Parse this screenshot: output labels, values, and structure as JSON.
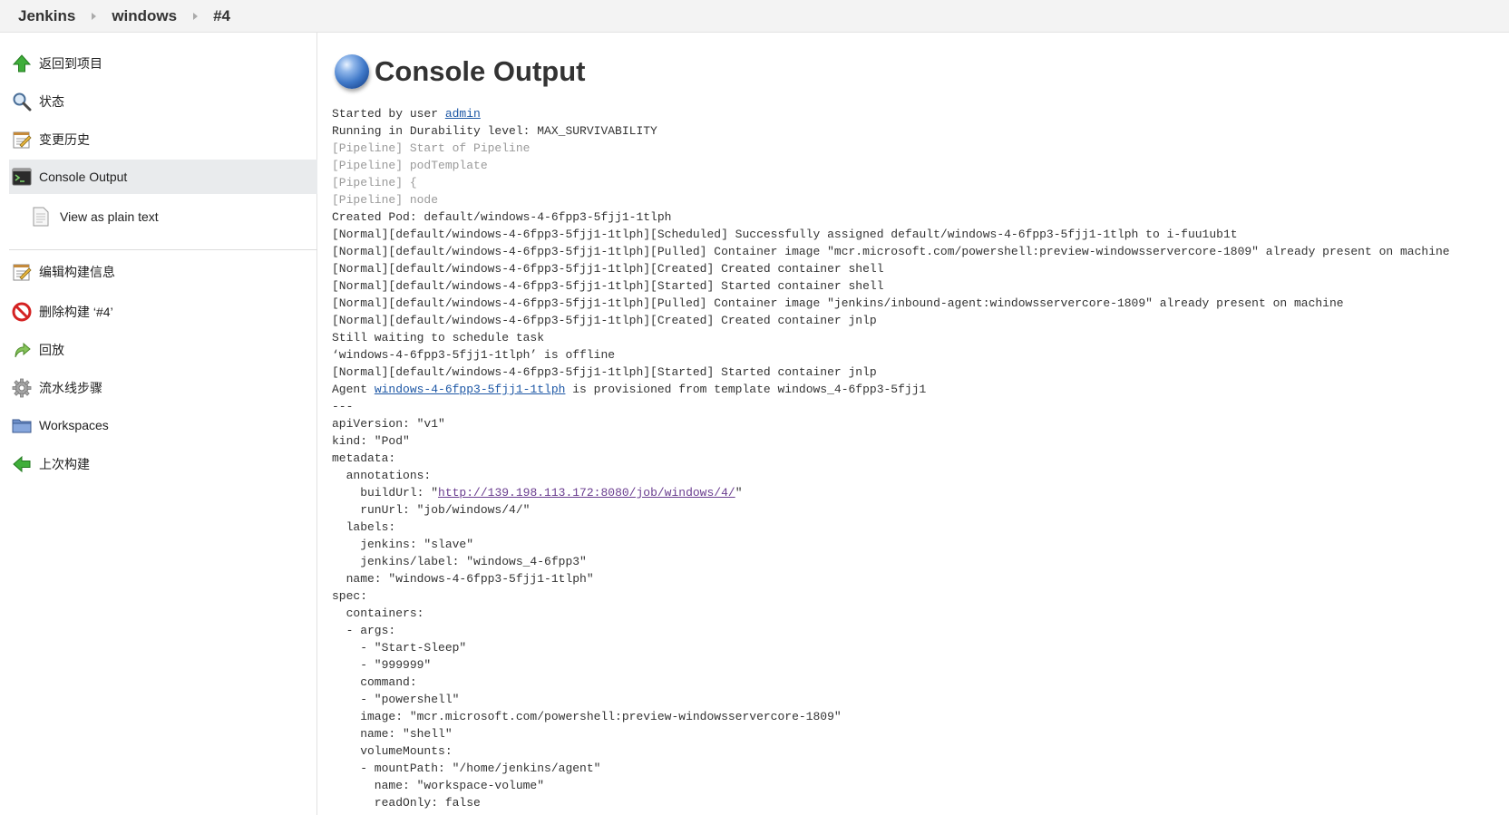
{
  "breadcrumb": {
    "items": [
      "Jenkins",
      "windows",
      "#4"
    ]
  },
  "sidebar": {
    "items": [
      {
        "label": "返回到项目",
        "icon": "up-arrow-icon"
      },
      {
        "label": "状态",
        "icon": "magnifier-icon"
      },
      {
        "label": "变更历史",
        "icon": "notepad-icon"
      },
      {
        "label": "Console Output",
        "icon": "terminal-icon",
        "active": true
      },
      {
        "label": "View as plain text",
        "icon": "document-icon"
      },
      {
        "label": "编辑构建信息",
        "icon": "notepad-icon"
      },
      {
        "label": "删除构建 ‘#4’",
        "icon": "no-entry-icon"
      },
      {
        "label": "回放",
        "icon": "redo-icon"
      },
      {
        "label": "流水线步骤",
        "icon": "gear-icon"
      },
      {
        "label": "Workspaces",
        "icon": "folder-icon"
      },
      {
        "label": "上次构建",
        "icon": "left-arrow-icon"
      }
    ]
  },
  "main": {
    "title": "Console Output",
    "lines": [
      {
        "parts": [
          {
            "t": "Started by user "
          },
          {
            "t": "admin",
            "link": true
          }
        ]
      },
      {
        "parts": [
          {
            "t": "Running in Durability level: MAX_SURVIVABILITY"
          }
        ]
      },
      {
        "parts": [
          {
            "t": "[Pipeline] Start of Pipeline",
            "dim": true
          }
        ]
      },
      {
        "parts": [
          {
            "t": "[Pipeline] podTemplate",
            "dim": true
          }
        ]
      },
      {
        "parts": [
          {
            "t": "[Pipeline] {",
            "dim": true
          }
        ]
      },
      {
        "parts": [
          {
            "t": "[Pipeline] node",
            "dim": true
          }
        ]
      },
      {
        "parts": [
          {
            "t": "Created Pod: default/windows-4-6fpp3-5fjj1-1tlph"
          }
        ]
      },
      {
        "parts": [
          {
            "t": "[Normal][default/windows-4-6fpp3-5fjj1-1tlph][Scheduled] Successfully assigned default/windows-4-6fpp3-5fjj1-1tlph to i-fuu1ub1t"
          }
        ]
      },
      {
        "parts": [
          {
            "t": "[Normal][default/windows-4-6fpp3-5fjj1-1tlph][Pulled] Container image \"mcr.microsoft.com/powershell:preview-windowsservercore-1809\" already present on machine"
          }
        ]
      },
      {
        "parts": [
          {
            "t": "[Normal][default/windows-4-6fpp3-5fjj1-1tlph][Created] Created container shell"
          }
        ]
      },
      {
        "parts": [
          {
            "t": "[Normal][default/windows-4-6fpp3-5fjj1-1tlph][Started] Started container shell"
          }
        ]
      },
      {
        "parts": [
          {
            "t": "[Normal][default/windows-4-6fpp3-5fjj1-1tlph][Pulled] Container image \"jenkins/inbound-agent:windowsservercore-1809\" already present on machine"
          }
        ]
      },
      {
        "parts": [
          {
            "t": "[Normal][default/windows-4-6fpp3-5fjj1-1tlph][Created] Created container jnlp"
          }
        ]
      },
      {
        "parts": [
          {
            "t": "Still waiting to schedule task"
          }
        ]
      },
      {
        "parts": [
          {
            "t": "‘windows-4-6fpp3-5fjj1-1tlph’ is offline"
          }
        ]
      },
      {
        "parts": [
          {
            "t": "[Normal][default/windows-4-6fpp3-5fjj1-1tlph][Started] Started container jnlp"
          }
        ]
      },
      {
        "parts": [
          {
            "t": "Agent "
          },
          {
            "t": "windows-4-6fpp3-5fjj1-1tlph",
            "link": true
          },
          {
            "t": " is provisioned from template windows_4-6fpp3-5fjj1"
          }
        ]
      },
      {
        "parts": [
          {
            "t": "---"
          }
        ]
      },
      {
        "parts": [
          {
            "t": "apiVersion: \"v1\""
          }
        ]
      },
      {
        "parts": [
          {
            "t": "kind: \"Pod\""
          }
        ]
      },
      {
        "parts": [
          {
            "t": "metadata:"
          }
        ]
      },
      {
        "parts": [
          {
            "t": "  annotations:"
          }
        ]
      },
      {
        "parts": [
          {
            "t": "    buildUrl: \""
          },
          {
            "t": "http://139.198.113.172:8080/job/windows/4/",
            "link": true,
            "visited": true
          },
          {
            "t": "\""
          }
        ]
      },
      {
        "parts": [
          {
            "t": "    runUrl: \"job/windows/4/\""
          }
        ]
      },
      {
        "parts": [
          {
            "t": "  labels:"
          }
        ]
      },
      {
        "parts": [
          {
            "t": "    jenkins: \"slave\""
          }
        ]
      },
      {
        "parts": [
          {
            "t": "    jenkins/label: \"windows_4-6fpp3\""
          }
        ]
      },
      {
        "parts": [
          {
            "t": "  name: \"windows-4-6fpp3-5fjj1-1tlph\""
          }
        ]
      },
      {
        "parts": [
          {
            "t": "spec:"
          }
        ]
      },
      {
        "parts": [
          {
            "t": "  containers:"
          }
        ]
      },
      {
        "parts": [
          {
            "t": "  - args:"
          }
        ]
      },
      {
        "parts": [
          {
            "t": "    - \"Start-Sleep\""
          }
        ]
      },
      {
        "parts": [
          {
            "t": "    - \"999999\""
          }
        ]
      },
      {
        "parts": [
          {
            "t": "    command:"
          }
        ]
      },
      {
        "parts": [
          {
            "t": "    - \"powershell\""
          }
        ]
      },
      {
        "parts": [
          {
            "t": "    image: \"mcr.microsoft.com/powershell:preview-windowsservercore-1809\""
          }
        ]
      },
      {
        "parts": [
          {
            "t": "    name: \"shell\""
          }
        ]
      },
      {
        "parts": [
          {
            "t": "    volumeMounts:"
          }
        ]
      },
      {
        "parts": [
          {
            "t": "    - mountPath: \"/home/jenkins/agent\""
          }
        ]
      },
      {
        "parts": [
          {
            "t": "      name: \"workspace-volume\""
          }
        ]
      },
      {
        "parts": [
          {
            "t": "      readOnly: false"
          }
        ]
      }
    ]
  }
}
